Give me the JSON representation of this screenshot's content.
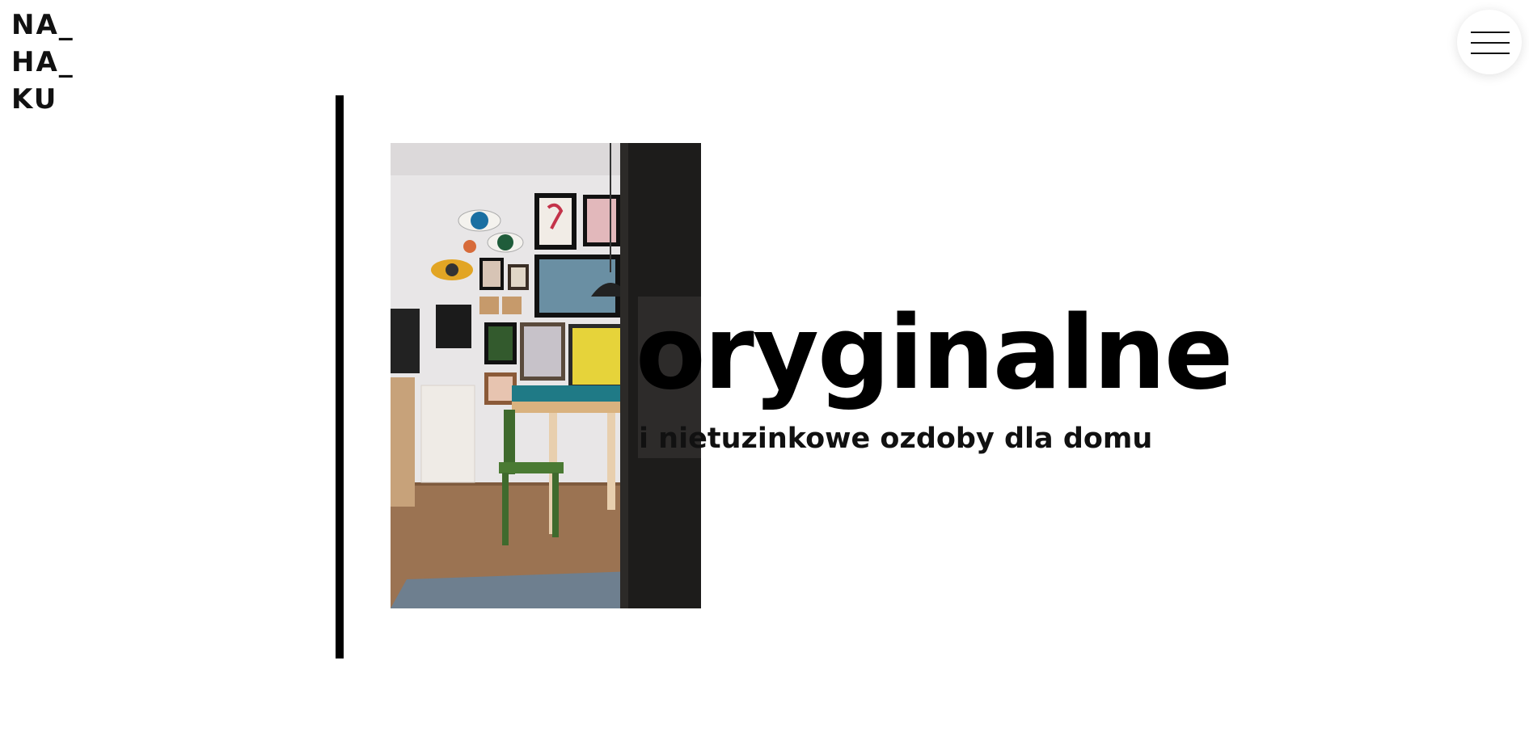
{
  "logo": {
    "line1": "NA_",
    "line2": "HA_",
    "line3": "KU"
  },
  "menu": {
    "icon": "hamburger-icon"
  },
  "hero": {
    "headline": "oryginalne",
    "subheadline": "i nietuzinkowe ozdoby dla domu",
    "image_alt": "dining room with gallery wall"
  },
  "colors": {
    "background": "#ffffff",
    "text": "#000000",
    "accent_bar": "#000000"
  }
}
